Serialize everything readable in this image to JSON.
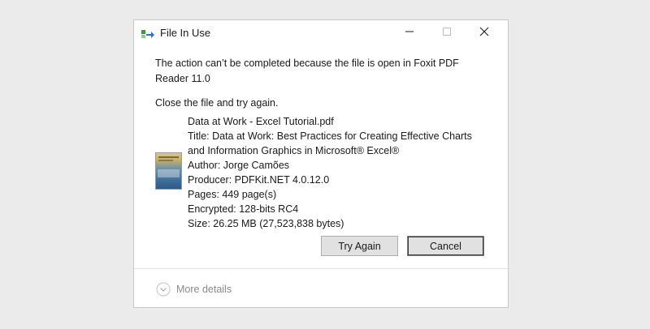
{
  "window": {
    "title": "File In Use",
    "icon": "file-in-use-icon",
    "controls": {
      "minimize": "minimize-icon",
      "maximize": "maximize-icon",
      "close": "close-icon"
    }
  },
  "message": "The action can’t be completed because the file is open in Foxit PDF Reader 11.0",
  "instruction": "Close the file and try again.",
  "file": {
    "name": "Data at Work - Excel Tutorial.pdf",
    "title": "Title: Data at Work: Best Practices for Creating Effective Charts and Information Graphics in Microsoft® Excel®",
    "author": "Author: Jorge Camões",
    "producer": "Producer: PDFKit.NET 4.0.12.0",
    "pages": "Pages: 449 page(s)",
    "encrypted": "Encrypted: 128-bits RC4",
    "size": "Size: 26.25 MB (27,523,838 bytes)"
  },
  "buttons": {
    "try_again": "Try Again",
    "cancel": "Cancel"
  },
  "footer": {
    "more_details": "More details",
    "icon": "chevron-down-circle-icon"
  },
  "colors": {
    "background": "#ebebeb",
    "dialog": "#ffffff",
    "button": "#e1e1e1",
    "muted_text": "#8a8a8a"
  }
}
